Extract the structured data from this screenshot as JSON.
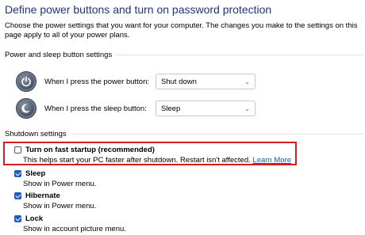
{
  "header": {
    "title": "Define power buttons and turn on password protection",
    "description": "Choose the power settings that you want for your computer. The changes you make to the settings on this page apply to all of your power plans."
  },
  "power_sleep": {
    "section_label": "Power and sleep button settings",
    "power_button": {
      "label": "When I press the power button:",
      "value": "Shut down"
    },
    "sleep_button": {
      "label": "When I press the sleep button:",
      "value": "Sleep"
    }
  },
  "shutdown": {
    "section_label": "Shutdown settings",
    "fast_startup": {
      "label": "Turn on fast startup (recommended)",
      "description": "This helps start your PC faster after shutdown. Restart isn't affected.",
      "link": "Learn More",
      "checked": false
    },
    "sleep": {
      "label": "Sleep",
      "description": "Show in Power menu.",
      "checked": true
    },
    "hibernate": {
      "label": "Hibernate",
      "description": "Show in Power menu.",
      "checked": true
    },
    "lock": {
      "label": "Lock",
      "description": "Show in account picture menu.",
      "checked": true
    }
  },
  "colors": {
    "title": "#1e3287",
    "highlight": "#d61d24",
    "checkbox": "#1f5fbf",
    "link": "#1a56c7"
  }
}
